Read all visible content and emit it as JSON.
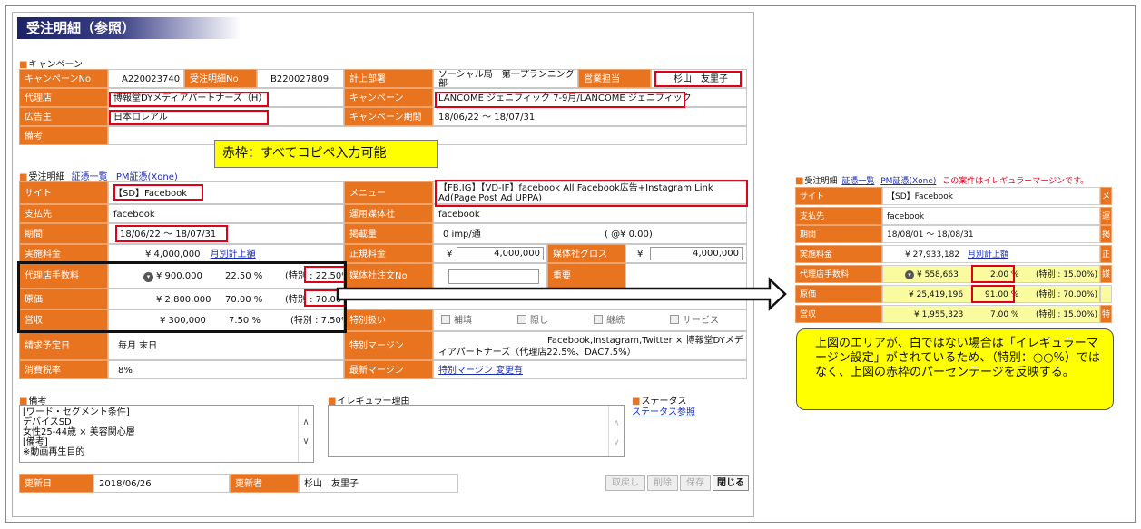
{
  "page": {
    "title": "受注明細（参照）"
  },
  "campaign": {
    "header": "キャンペーン",
    "campaign_no_label": "キャンペーンNo",
    "campaign_no": "A220023740",
    "order_detail_no_label": "受注明細No",
    "order_detail_no": "B220027809",
    "dept_label": "計上部署",
    "dept": "ソーシャル局　第一プランニング部",
    "sales_label": "営業担当",
    "sales": "杉山　友里子",
    "agency_label": "代理店",
    "agency": "博報堂DYメディアパートナーズ（H）",
    "campaign_label": "キャンペーン",
    "campaign_name": "LANCOME ジェニフィック 7-9月/LANCOME ジェニフィック",
    "advertiser_label": "広告主",
    "advertiser": "日本ロレアル",
    "period_label": "キャンペーン期間",
    "period": "18/06/22 ～ 18/07/31",
    "remarks_label": "備考",
    "remarks": ""
  },
  "callout_red": "赤枠：すべてコピペ入力可能",
  "order": {
    "header": "受注明細",
    "link_list": "証憑一覧",
    "link_pm": "PM証憑(Xone)",
    "site_label": "サイト",
    "site": "【SD】Facebook",
    "menu_label": "メニュー",
    "menu": "【FB,IG】【VD-IF】facebook All Facebook広告+Instagram Link Ad(Page Post Ad UPPA)",
    "payee_label": "支払先",
    "payee": "facebook",
    "media_company_label": "運用媒体社",
    "media_company": "facebook",
    "period_label": "期間",
    "period": "18/06/22 ～ 18/07/31",
    "placement_label": "掲載量",
    "placement": "0 imp/通",
    "placement_unit": "( @¥ 0.00)",
    "exec_fee_label": "実施料金",
    "exec_fee": "¥ 4,000,000",
    "exec_fee_link": "月別計上額",
    "regular_fee_label": "正規料金",
    "regular_fee_yen": "¥",
    "regular_fee": "4,000,000",
    "media_gross_label": "媒体社グロス",
    "media_gross_yen": "¥",
    "media_gross": "4,000,000",
    "agency_fee_label": "代理店手数料",
    "agency_fee": "¥ 900,000",
    "agency_fee_pct": "22.50 %",
    "agency_fee_special": "(特別 : 22.50%)",
    "cost_label": "原価",
    "cost": "¥ 2,800,000",
    "cost_pct": "70.00 %",
    "cost_special": "(特別 : 70.00%)",
    "revenue_label": "営収",
    "revenue": "¥ 300,000",
    "revenue_pct": "7.50 %",
    "revenue_special": "(特別 : 7.50%)",
    "media_order_no_label": "媒体社注文No",
    "media_order_no": "",
    "important_label": "重要",
    "special_handling_label": "特別扱い",
    "checks": [
      "補填",
      "隠し",
      "継続",
      "サービス"
    ],
    "billing_date_label": "請求予定日",
    "billing_date": "毎月 末日",
    "special_margin_label": "特別マージン",
    "special_margin": "Facebook,Instagram,Twitter × 博報堂DYメディアパートナーズ（代理店22.5%、DAC7.5%）",
    "tax_label": "消費税率",
    "tax": "8%",
    "latest_margin_label": "最新マージン",
    "latest_margin": "特別マージン 変更有"
  },
  "notes": {
    "remarks_header": "備考",
    "remarks_lines": [
      "[ワード・セグメント条件]",
      "デバイスSD",
      "女性25-44歳 × 美容関心層",
      "[備考]",
      "※動画再生目的"
    ],
    "irregular_header": "イレギュラー理由",
    "status_header": "ステータス",
    "status_link": "ステータス参照"
  },
  "footer": {
    "updated_label": "更新日",
    "updated": "2018/06/26",
    "updater_label": "更新者",
    "updater": "杉山　友里子",
    "btn_revert": "取戻し",
    "btn_delete": "削除",
    "btn_save": "保存",
    "btn_close": "閉じる"
  },
  "mini": {
    "header": "受注明細",
    "link_list": "証憑一覧",
    "link_pm": "PM証憑(Xone)",
    "warning": "この案件はイレギュラーマージンです。",
    "site_label": "サイト",
    "site": "【SD】Facebook",
    "payee_label": "支払先",
    "payee": "facebook",
    "period_label": "期間",
    "period": "18/08/01 ～ 18/08/31",
    "exec_fee_label": "実施料金",
    "exec_fee": "¥ 27,933,182",
    "exec_fee_link": "月別計上額",
    "agency_fee_label": "代理店手数料",
    "agency_fee": "¥ 558,663",
    "agency_fee_pct": "2.00 %",
    "agency_fee_special": "(特別 : 15.00%)",
    "cost_label": "原価",
    "cost": "¥ 25,419,196",
    "cost_pct": "91.00 %",
    "cost_special": "(特別 : 70.00%)",
    "revenue_label": "営収",
    "revenue": "¥ 1,955,323",
    "revenue_pct": "7.00 %",
    "revenue_special": "(特別 : 15.00%)",
    "edge_labels": [
      "メ",
      "運",
      "掲",
      "正",
      "媒",
      "",
      "特"
    ]
  },
  "callout_yellow": "上図のエリアが、白ではない場合は「イレギュラーマージン設定」がされているため、（特別：○○%）ではなく、上図の赤枠のパーセンテージを反映する。",
  "colors": {
    "label_orange": "#e8741f",
    "highlight_yellow": "#ffff00",
    "red_frame": "#e0001a",
    "irregular_yellow": "#fafa9e"
  }
}
